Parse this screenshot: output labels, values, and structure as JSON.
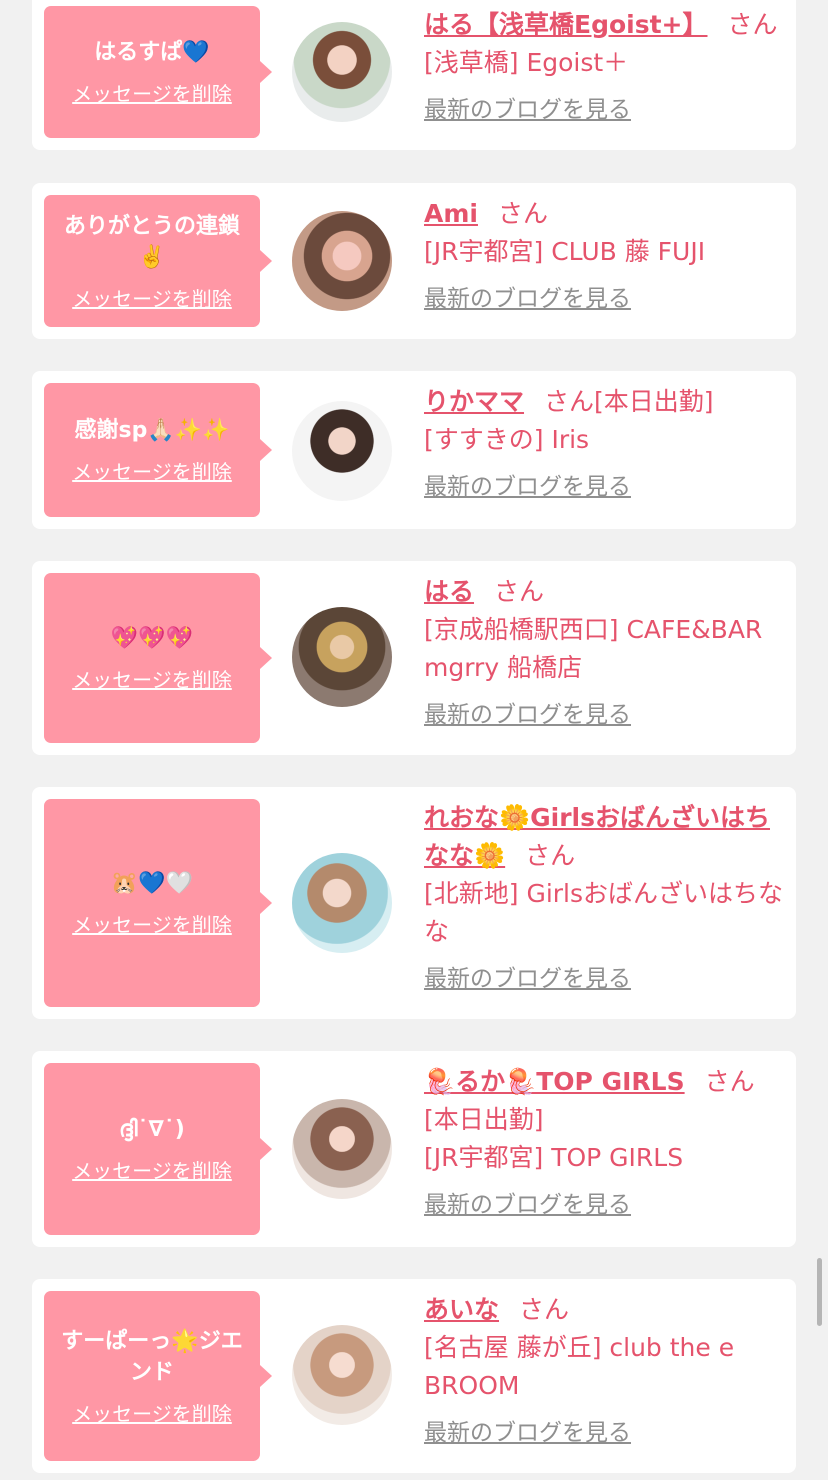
{
  "cards": [
    {
      "message": "はるすぱ💙",
      "delete": "メッセージを削除",
      "name": "はる【浅草橋Egoist+】",
      "san": "さん",
      "tag": "",
      "shop": [
        "[浅草橋] Egoist＋"
      ],
      "blog": "最新のブログを見る"
    },
    {
      "message": "ありがとうの連鎖✌️",
      "delete": "メッセージを削除",
      "name": "Ami",
      "san": "さん",
      "tag": "",
      "shop": [
        "[JR宇都宮] CLUB 藤 FUJI"
      ],
      "blog": "最新のブログを見る"
    },
    {
      "message": "感謝sp🙏🏻✨✨",
      "delete": "メッセージを削除",
      "name": "りかママ",
      "san": "さん",
      "tag": "[本日出勤]",
      "shop": [
        "[すすきの] Iris"
      ],
      "blog": "最新のブログを見る"
    },
    {
      "message": "💖💖💖",
      "delete": "メッセージを削除",
      "name": "はる",
      "san": "さん",
      "tag": "",
      "shop": [
        "[京成船橋駅西口] CAFE&BAR mgrry 船橋店"
      ],
      "blog": "最新のブログを見る"
    },
    {
      "message": "🐹💙🤍",
      "delete": "メッセージを削除",
      "name": "れおな🌼Girlsおばんざいはちなな🌼",
      "san": "さん",
      "tag": "",
      "shop": [
        "[北新地] Girlsおばんざいはちなな"
      ],
      "blog": "最新のブログを見る"
    },
    {
      "message": "ദ്ദി˙∇˙)",
      "delete": "メッセージを削除",
      "name": "🪼るか🪼TOP GIRLS",
      "san": "さん",
      "tag": "",
      "shop": [
        "[本日出勤]",
        "[JR宇都宮] TOP GIRLS"
      ],
      "blog": "最新のブログを見る"
    },
    {
      "message": "すーぱーっ🌟ジエンド",
      "delete": "メッセージを削除",
      "name": "あいな",
      "san": "さん",
      "tag": "",
      "shop": [
        "[名古屋 藤が丘] club the e BROOM"
      ],
      "blog": "最新のブログを見る"
    }
  ]
}
